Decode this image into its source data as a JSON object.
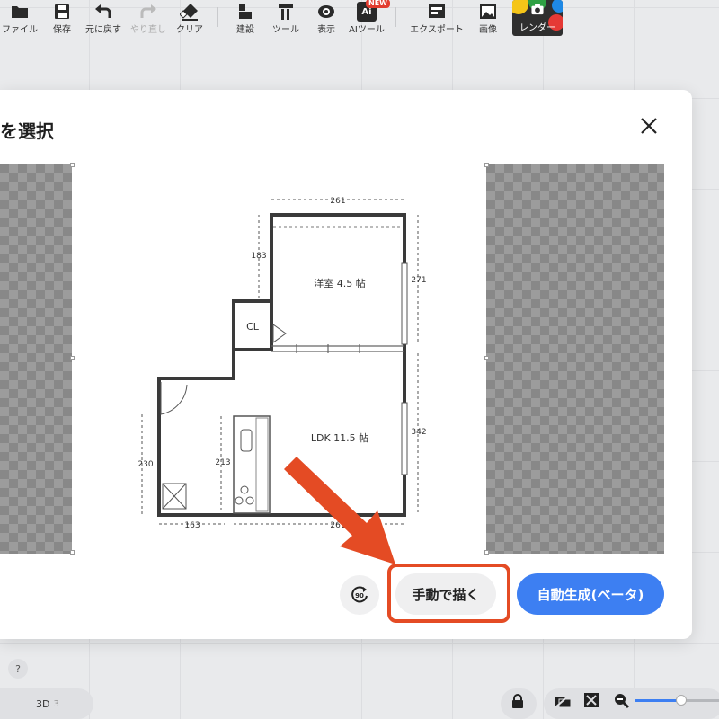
{
  "toolbar": {
    "items": [
      {
        "label": "ファイル",
        "icon": "folder-icon"
      },
      {
        "label": "保存",
        "icon": "save-icon"
      },
      {
        "label": "元に戻す",
        "icon": "undo-icon"
      },
      {
        "label": "やり直し",
        "icon": "redo-icon",
        "disabled": true
      },
      {
        "label": "クリア",
        "icon": "eraser-icon"
      },
      {
        "label": "建設",
        "icon": "build-icon"
      },
      {
        "label": "ツール",
        "icon": "tools-icon"
      },
      {
        "label": "表示",
        "icon": "eye-icon"
      },
      {
        "label": "AIツール",
        "icon": "ai-icon",
        "badge": "NEW"
      },
      {
        "label": "エクスポート",
        "icon": "export-icon"
      },
      {
        "label": "画像",
        "icon": "image-icon"
      }
    ],
    "render_label": "レンダー"
  },
  "modal": {
    "title": "画像を選択",
    "close_icon": "close-icon"
  },
  "floorplan": {
    "rooms": [
      {
        "label": "洋室 4.5 帖"
      },
      {
        "label": "CL"
      },
      {
        "label": "LDK 11.5 帖"
      }
    ],
    "dimensions": {
      "top": "261",
      "left_upper": "183",
      "right_upper": "271",
      "right_lower": "342",
      "left_lower": "230",
      "kitchen": "213",
      "bottom_left": "163",
      "bottom_right": "261"
    }
  },
  "actions": {
    "rotate_label": "90",
    "manual_label": "手動で描く",
    "auto_label": "自動生成(ベータ)"
  },
  "bottom": {
    "help": "?",
    "mode_label": "3D",
    "mode_sub": "3"
  },
  "colors": {
    "accent": "#3d7ff2",
    "highlight": "#e44b24",
    "wall": "#3a3a3a"
  }
}
